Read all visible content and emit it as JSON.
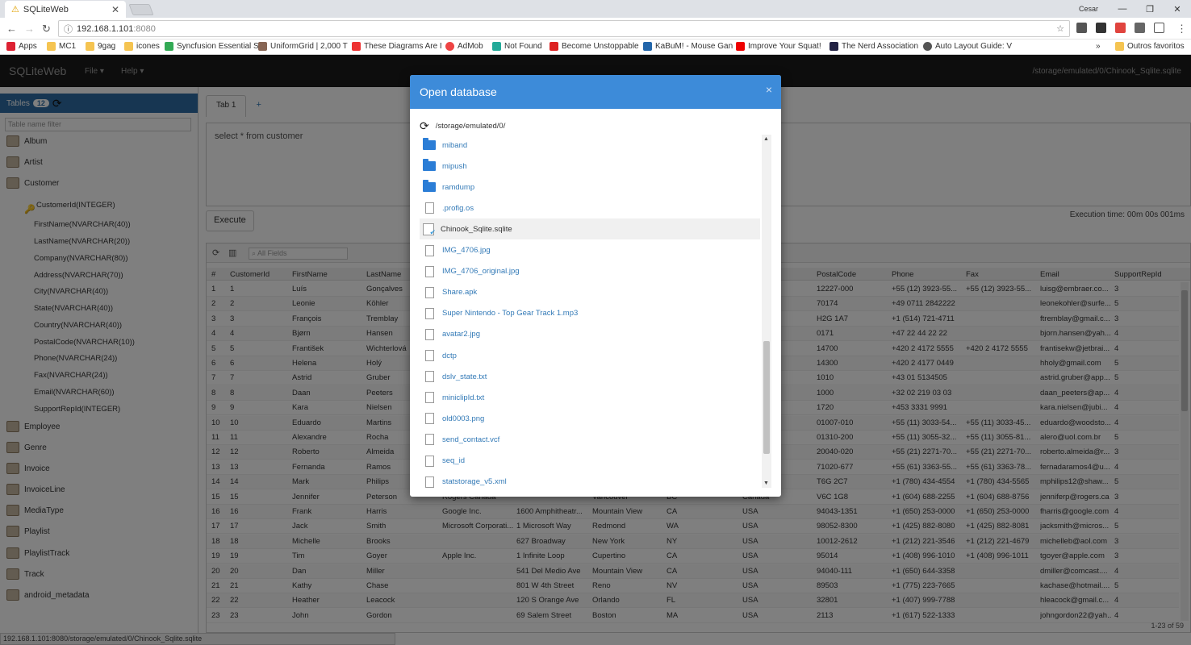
{
  "browser": {
    "tab_title": "SQLiteWeb",
    "user": "Cesar",
    "url_host": "192.168.1.101",
    "url_port": ":8080",
    "bookmarks": [
      "Apps",
      "MC1",
      "9gag",
      "icones",
      "Syncfusion Essential S",
      "UniformGrid | 2,000 T",
      "These Diagrams Are I",
      "AdMob",
      "Not Found",
      "Become Unstoppable",
      "KaBuM! - Mouse Gan",
      "Improve Your Squat!",
      "The Nerd Association",
      "Auto Layout Guide: V"
    ],
    "other_bookmarks": "Outros favoritos",
    "status_url": "192.168.1.101:8080/storage/emulated/0/Chinook_Sqlite.sqlite"
  },
  "app": {
    "brand": "SQLiteWeb",
    "menu_file": "File",
    "menu_help": "Help",
    "db_path": "/storage/emulated/0/Chinook_Sqlite.sqlite"
  },
  "sidebar": {
    "tables_label": "Tables",
    "tables_count": "12",
    "filter_placeholder": "Table name filter",
    "tables_before": [
      "Album",
      "Artist",
      "Customer"
    ],
    "customer_columns": [
      "CustomerId(INTEGER)",
      "FirstName(NVARCHAR(40))",
      "LastName(NVARCHAR(20))",
      "Company(NVARCHAR(80))",
      "Address(NVARCHAR(70))",
      "City(NVARCHAR(40))",
      "State(NVARCHAR(40))",
      "Country(NVARCHAR(40))",
      "PostalCode(NVARCHAR(10))",
      "Phone(NVARCHAR(24))",
      "Fax(NVARCHAR(24))",
      "Email(NVARCHAR(60))",
      "SupportRepId(INTEGER)"
    ],
    "tables_after": [
      "Employee",
      "Genre",
      "Invoice",
      "InvoiceLine",
      "MediaType",
      "Playlist",
      "PlaylistTrack",
      "Track",
      "android_metadata"
    ]
  },
  "query": {
    "tab_label": "Tab 1",
    "add_tab": "+",
    "sql": "select * from customer",
    "execute_label": "Execute",
    "exec_time": "Execution time: 00m 00s 001ms"
  },
  "grid": {
    "search_placeholder": "All Fields",
    "columns": [
      "#",
      "CustomerId",
      "FirstName",
      "LastName",
      "",
      "",
      "",
      "",
      "",
      "PostalCode",
      "Phone",
      "Fax",
      "Email",
      "SupportRepId"
    ],
    "rows": [
      [
        "1",
        "1",
        "Luís",
        "Gonçalves",
        "",
        "",
        "",
        "",
        "",
        "12227-000",
        "+55 (12) 3923-55...",
        "+55 (12) 3923-55...",
        "luisg@embraer.co...",
        "3"
      ],
      [
        "2",
        "2",
        "Leonie",
        "Köhler",
        "",
        "",
        "",
        "",
        "",
        "70174",
        "+49 0711 2842222",
        "",
        "leonekohler@surfe...",
        "5"
      ],
      [
        "3",
        "3",
        "François",
        "Tremblay",
        "",
        "",
        "",
        "",
        "",
        "H2G 1A7",
        "+1 (514) 721-4711",
        "",
        "ftremblay@gmail.c...",
        "3"
      ],
      [
        "4",
        "4",
        "Bjørn",
        "Hansen",
        "",
        "",
        "",
        "",
        "",
        "0171",
        "+47 22 44 22 22",
        "",
        "bjorn.hansen@yah...",
        "4"
      ],
      [
        "5",
        "5",
        "František",
        "Wichterlová",
        "",
        "",
        "",
        "",
        "blic",
        "14700",
        "+420 2 4172 5555",
        "+420 2 4172 5555",
        "frantisekw@jetbrai...",
        "4"
      ],
      [
        "6",
        "6",
        "Helena",
        "Holý",
        "",
        "",
        "",
        "",
        "blic",
        "14300",
        "+420 2 4177 0449",
        "",
        "hholy@gmail.com",
        "5"
      ],
      [
        "7",
        "7",
        "Astrid",
        "Gruber",
        "",
        "",
        "",
        "",
        "",
        "1010",
        "+43 01 5134505",
        "",
        "astrid.gruber@app...",
        "5"
      ],
      [
        "8",
        "8",
        "Daan",
        "Peeters",
        "",
        "",
        "",
        "",
        "",
        "1000",
        "+32 02 219 03 03",
        "",
        "daan_peeters@ap...",
        "4"
      ],
      [
        "9",
        "9",
        "Kara",
        "Nielsen",
        "",
        "",
        "",
        "",
        "",
        "1720",
        "+453 3331 9991",
        "",
        "kara.nielsen@jubi...",
        "4"
      ],
      [
        "10",
        "10",
        "Eduardo",
        "Martins",
        "",
        "",
        "",
        "",
        "",
        "01007-010",
        "+55 (11) 3033-54...",
        "+55 (11) 3033-45...",
        "eduardo@woodsto...",
        "4"
      ],
      [
        "11",
        "11",
        "Alexandre",
        "Rocha",
        "",
        "",
        "",
        "",
        "",
        "01310-200",
        "+55 (11) 3055-32...",
        "+55 (11) 3055-81...",
        "alero@uol.com.br",
        "5"
      ],
      [
        "12",
        "12",
        "Roberto",
        "Almeida",
        "",
        "",
        "",
        "",
        "",
        "20040-020",
        "+55 (21) 2271-70...",
        "+55 (21) 2271-70...",
        "roberto.almeida@r...",
        "3"
      ],
      [
        "13",
        "13",
        "Fernanda",
        "Ramos",
        "",
        "",
        "",
        "",
        "",
        "71020-677",
        "+55 (61) 3363-55...",
        "+55 (61) 3363-78...",
        "fernadaramos4@u...",
        "4"
      ],
      [
        "14",
        "14",
        "Mark",
        "Philips",
        "",
        "",
        "",
        "",
        "",
        "T6G 2C7",
        "+1 (780) 434-4554",
        "+1 (780) 434-5565",
        "mphilips12@shaw...",
        "5"
      ],
      [
        "15",
        "15",
        "Jennifer",
        "Peterson",
        "Rogers Canada",
        "",
        "Vancouver",
        "BC",
        "Canada",
        "V6C 1G8",
        "+1 (604) 688-2255",
        "+1 (604) 688-8756",
        "jenniferp@rogers.ca",
        "3"
      ],
      [
        "16",
        "16",
        "Frank",
        "Harris",
        "Google Inc.",
        "1600 Amphitheatr...",
        "Mountain View",
        "CA",
        "USA",
        "94043-1351",
        "+1 (650) 253-0000",
        "+1 (650) 253-0000",
        "fharris@google.com",
        "4"
      ],
      [
        "17",
        "17",
        "Jack",
        "Smith",
        "Microsoft Corporati...",
        "1 Microsoft Way",
        "Redmond",
        "WA",
        "USA",
        "98052-8300",
        "+1 (425) 882-8080",
        "+1 (425) 882-8081",
        "jacksmith@micros...",
        "5"
      ],
      [
        "18",
        "18",
        "Michelle",
        "Brooks",
        "",
        "627 Broadway",
        "New York",
        "NY",
        "USA",
        "10012-2612",
        "+1 (212) 221-3546",
        "+1 (212) 221-4679",
        "michelleb@aol.com",
        "3"
      ],
      [
        "19",
        "19",
        "Tim",
        "Goyer",
        "Apple Inc.",
        "1 Infinite Loop",
        "Cupertino",
        "CA",
        "USA",
        "95014",
        "+1 (408) 996-1010",
        "+1 (408) 996-1011",
        "tgoyer@apple.com",
        "3"
      ],
      [
        "20",
        "20",
        "Dan",
        "Miller",
        "",
        "541 Del Medio Ave",
        "Mountain View",
        "CA",
        "USA",
        "94040-111",
        "+1 (650) 644-3358",
        "",
        "dmiller@comcast....",
        "4"
      ],
      [
        "21",
        "21",
        "Kathy",
        "Chase",
        "",
        "801 W 4th Street",
        "Reno",
        "NV",
        "USA",
        "89503",
        "+1 (775) 223-7665",
        "",
        "kachase@hotmail....",
        "5"
      ],
      [
        "22",
        "22",
        "Heather",
        "Leacock",
        "",
        "120 S Orange Ave",
        "Orlando",
        "FL",
        "USA",
        "32801",
        "+1 (407) 999-7788",
        "",
        "hleacock@gmail.c...",
        "4"
      ],
      [
        "23",
        "23",
        "John",
        "Gordon",
        "",
        "69 Salem Street",
        "Boston",
        "MA",
        "USA",
        "2113",
        "+1 (617) 522-1333",
        "",
        "johngordon22@yah...",
        "4"
      ]
    ],
    "footer": "1-23 of 59"
  },
  "modal": {
    "title": "Open database",
    "close": "×",
    "path": "/storage/emulated/0/",
    "items": [
      {
        "name": "miband",
        "type": "folder"
      },
      {
        "name": "mipush",
        "type": "folder"
      },
      {
        "name": "ramdump",
        "type": "folder"
      },
      {
        "name": ".profig.os",
        "type": "file"
      },
      {
        "name": "Chinook_Sqlite.sqlite",
        "type": "db",
        "selected": true
      },
      {
        "name": "IMG_4706.jpg",
        "type": "file"
      },
      {
        "name": "IMG_4706_original.jpg",
        "type": "file"
      },
      {
        "name": "Share.apk",
        "type": "file"
      },
      {
        "name": "Super Nintendo - Top Gear Track 1.mp3",
        "type": "file"
      },
      {
        "name": "avatar2.jpg",
        "type": "file"
      },
      {
        "name": "dctp",
        "type": "file"
      },
      {
        "name": "dslv_state.txt",
        "type": "file"
      },
      {
        "name": "miniclipId.txt",
        "type": "file"
      },
      {
        "name": "old0003.png",
        "type": "file"
      },
      {
        "name": "send_contact.vcf",
        "type": "file"
      },
      {
        "name": "seq_id",
        "type": "file"
      },
      {
        "name": "statstorage_v5.xml",
        "type": "file"
      }
    ]
  },
  "colors": {
    "accent": "#3d8bd9",
    "navbar": "#1b1b1b",
    "sidebar_head": "#2e6da4"
  }
}
